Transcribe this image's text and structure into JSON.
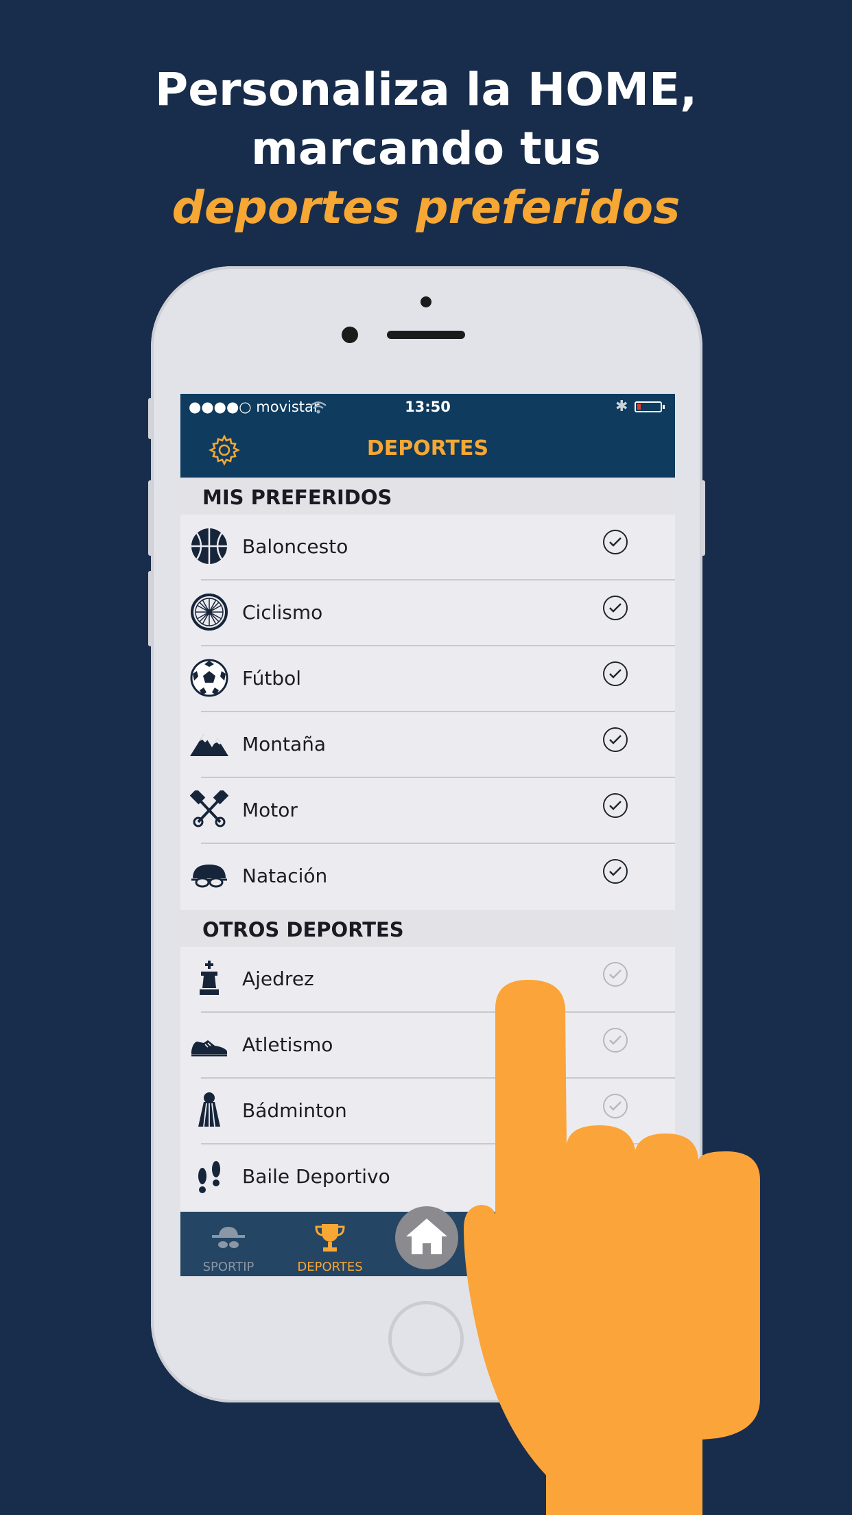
{
  "headline": {
    "line1": "Personaliza la HOME,",
    "line2": "marcando tus",
    "line3": "deportes preferidos"
  },
  "status_bar": {
    "carrier": "●●●●○ movistar",
    "time": "13:50"
  },
  "nav": {
    "title": "DEPORTES"
  },
  "sections": {
    "favorites_title": "MIS PREFERIDOS",
    "others_title": "OTROS DEPORTES"
  },
  "favorites": [
    {
      "label": "Baloncesto",
      "icon": "basketball-icon",
      "checked": true
    },
    {
      "label": "Ciclismo",
      "icon": "bicycle-wheel-icon",
      "checked": true
    },
    {
      "label": "Fútbol",
      "icon": "soccer-ball-icon",
      "checked": true
    },
    {
      "label": "Montaña",
      "icon": "mountain-icon",
      "checked": true
    },
    {
      "label": "Motor",
      "icon": "crossed-pistons-icon",
      "checked": true
    },
    {
      "label": "Natación",
      "icon": "swim-cap-goggles-icon",
      "checked": true
    }
  ],
  "others": [
    {
      "label": "Ajedrez",
      "icon": "chess-king-icon",
      "checked": false
    },
    {
      "label": "Atletismo",
      "icon": "running-shoe-icon",
      "checked": false
    },
    {
      "label": "Bádminton",
      "icon": "shuttlecock-icon",
      "checked": false
    },
    {
      "label": "Baile Deportivo",
      "icon": "footprints-icon",
      "checked": false
    }
  ],
  "tabbar": {
    "tab1": "SPORTIP",
    "tab2": "DEPORTES"
  },
  "colors": {
    "background": "#182d4b",
    "accent": "#f6a734",
    "navbar": "#0e3b5e",
    "hand": "#fba43a"
  }
}
